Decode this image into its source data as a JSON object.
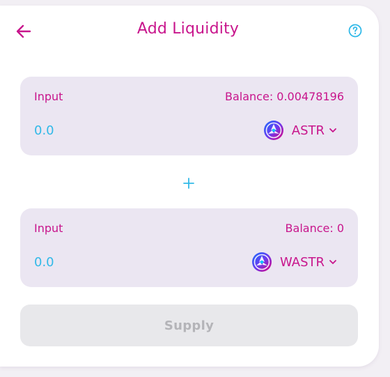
{
  "header": {
    "title": "Add Liquidity",
    "back_icon": "arrow-left-icon",
    "help_icon": "question-circle-icon"
  },
  "input_a": {
    "label": "Input",
    "balance": "Balance: 0.00478196",
    "amount": "0.0",
    "token": "ASTR",
    "token_icon": "astar-logo-icon"
  },
  "separator": {
    "icon": "plus-icon"
  },
  "input_b": {
    "label": "Input",
    "balance": "Balance: 0",
    "amount": "0.0",
    "token": "WASTR",
    "token_icon": "astar-logo-icon"
  },
  "supply": {
    "label": "Supply",
    "state": "disabled"
  },
  "colors": {
    "accent": "#c8158c",
    "amount": "#31b9e8",
    "panel": "#ebe6f2",
    "disabled_bg": "#e8e8eb",
    "disabled_text": "#b4b4b8"
  }
}
